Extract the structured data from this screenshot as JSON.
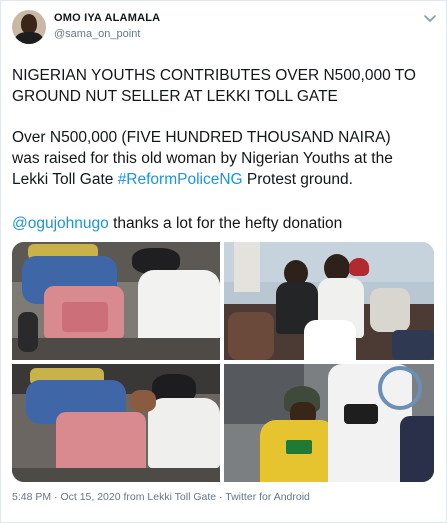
{
  "author": {
    "name": "OMO IYA ALAMALA",
    "handle": "@sama_on_point"
  },
  "menu_icon": "chevron-down-icon",
  "tweet": {
    "headline_line1": "NIGERIAN YOUTHS CONTRIBUTES OVER N500,000 TO",
    "headline_line2": "GROUND NUT SELLER AT LEKKI TOLL GATE",
    "body_line1": "Over N500,000 (FIVE HUNDRED THOUSAND NAIRA)",
    "body_line2": "was raised for this old woman by Nigerian Youths at the",
    "body_line3_pre": "Lekki Toll Gate ",
    "hashtag": "#ReformPoliceNG",
    "body_line3_post": " Protest ground.",
    "mention": "@ogujohnugo",
    "mention_text": " thanks a lot for the hefty donation"
  },
  "photos": [
    {
      "name": "photo-woman-seated-left"
    },
    {
      "name": "photo-youths-group"
    },
    {
      "name": "photo-woman-seated-closeup"
    },
    {
      "name": "photo-man-yellow-shirt"
    }
  ],
  "footer": {
    "time": "5:48 PM",
    "sep1": " · ",
    "date": "Oct 15, 2020",
    "from": " from ",
    "location": "Lekki Toll Gate",
    "sep2": " · ",
    "source": "Twitter for Android"
  },
  "colors": {
    "link": "#1b95e0",
    "muted": "#657786",
    "text": "#14171a"
  }
}
